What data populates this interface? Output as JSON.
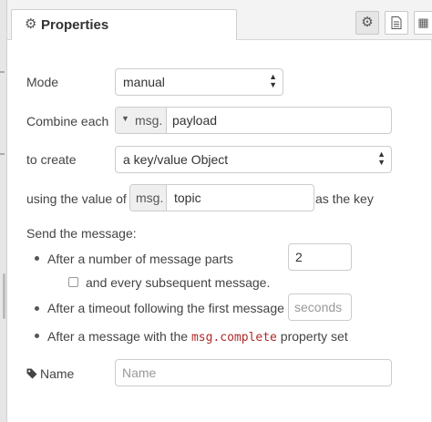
{
  "header": {
    "tab_title": "Properties",
    "tab_icon": "gear-icon",
    "buttons": [
      {
        "name": "settings-toggle",
        "icon": "gear-icon"
      },
      {
        "name": "description-toggle",
        "icon": "document-icon"
      },
      {
        "name": "appearance-toggle",
        "icon": "palette-icon"
      }
    ]
  },
  "form": {
    "mode_label": "Mode",
    "mode_value": "manual",
    "combine_label": "Combine each",
    "combine_prefix": "msg.",
    "combine_value": "payload",
    "create_label": "to create",
    "create_value": "a key/value Object",
    "using_label": "using the value of",
    "using_prefix": "msg.",
    "using_value": "topic",
    "as_key_label": "as the key",
    "send_label": "Send the message:",
    "parts_label": "After a number of message parts",
    "parts_value": "2",
    "subsequent_label": "and every subsequent message.",
    "timeout_label": "After a timeout following the first message",
    "timeout_placeholder": "seconds",
    "complete_prefix": "After a message with the",
    "complete_code": "msg.complete",
    "complete_suffix": "property set",
    "name_label": "Name",
    "name_placeholder": "Name"
  },
  "colors": {
    "code_text": "#b02a2a",
    "border": "#cccccc",
    "type_bg": "#efefef"
  }
}
